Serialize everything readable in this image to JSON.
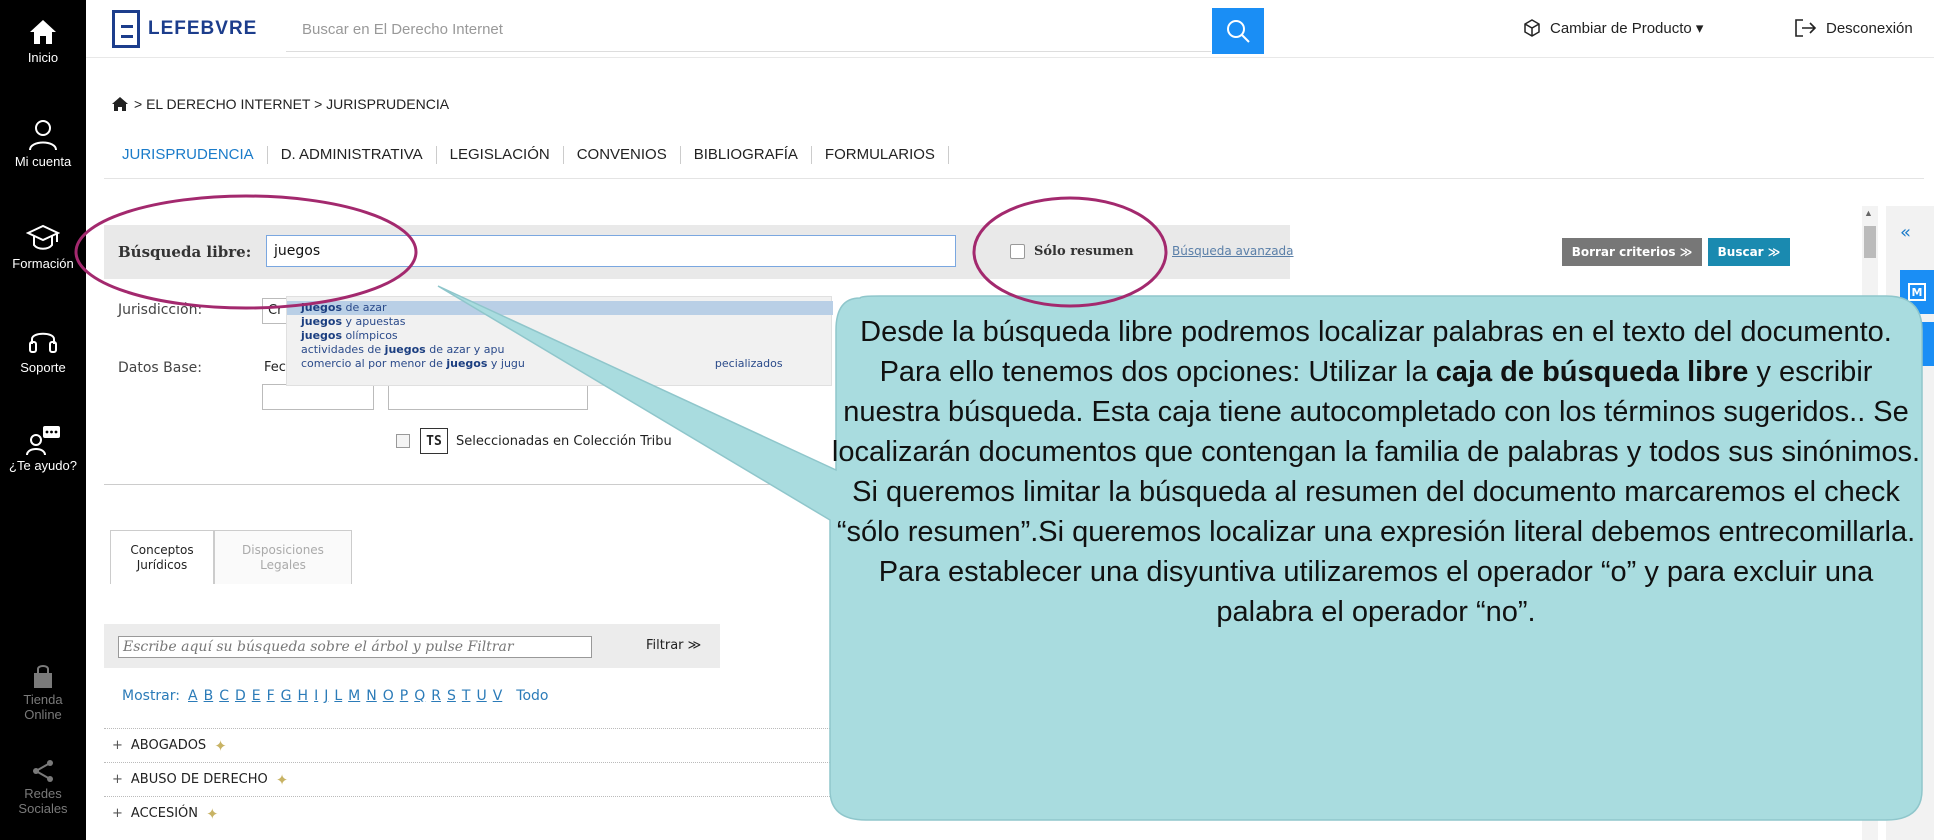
{
  "left_nav": [
    {
      "label": "Inicio",
      "icon": "home-icon"
    },
    {
      "label": "Mi cuenta",
      "icon": "user-icon"
    },
    {
      "label": "Formación",
      "icon": "graduation-cap-icon"
    },
    {
      "label": "Soporte",
      "icon": "headset-icon"
    },
    {
      "label": "¿Te ayudo?",
      "icon": "chat-user-icon"
    },
    {
      "label": "Tienda Online",
      "icon": "shopping-bag-icon"
    },
    {
      "label": "Redes Sociales",
      "icon": "share-icon"
    }
  ],
  "topbar": {
    "logo_text": "LEFEBVRE",
    "search_placeholder": "Buscar en El Derecho Internet",
    "change_product": "Cambiar de Producto ▾",
    "logout": "Desconexión"
  },
  "breadcrumb": "> EL DERECHO INTERNET > JURISPRUDENCIA",
  "tabs": [
    "JURISPRUDENCIA",
    "D. ADMINISTRATIVA",
    "LEGISLACIÓN",
    "CONVENIOS",
    "BIBLIOGRAFÍA",
    "FORMULARIOS"
  ],
  "search": {
    "label": "Búsqueda libre:",
    "value": "juegos",
    "only_summary": "Sólo resumen",
    "advanced_link": "Búsqueda avanzada",
    "clear_button": "Borrar criterios ≫",
    "search_button": "Buscar ≫"
  },
  "autocomplete": [
    {
      "bold": "juegos",
      "rest": " de azar",
      "selected": true
    },
    {
      "bold": "juegos",
      "rest": " y apuestas",
      "selected": false
    },
    {
      "bold": "juegos",
      "rest": " olímpicos",
      "selected": false
    },
    {
      "pre": "actividades de ",
      "bold": "juegos",
      "rest": " de azar y apu",
      "selected": false
    },
    {
      "pre": "comercio al por menor de ",
      "bold": "juegos",
      "rest": " y jugu",
      "tail": "pecializados",
      "selected": false
    }
  ],
  "form": {
    "jurisdiccion_label": "Jurisdicción:",
    "jurisdiccion_value": "Cr",
    "datos_base_label": "Datos Base:",
    "fecha_label": "Fec",
    "ts_badge": "TS",
    "ts_label": "Seleccionadas en Colección Tribu"
  },
  "concept_tabs": [
    "Conceptos\nJurídicos",
    "Disposiciones\nLegales"
  ],
  "filter": {
    "placeholder": "Escribe aquí su búsqueda sobre el árbol y pulse Filtrar",
    "button": "Filtrar ≫"
  },
  "mostrar": {
    "label": "Mostrar:",
    "letters": [
      "A",
      "B",
      "C",
      "D",
      "E",
      "F",
      "G",
      "H",
      "I",
      "J",
      "L",
      "M",
      "N",
      "O",
      "P",
      "Q",
      "R",
      "S",
      "T",
      "U",
      "V"
    ],
    "all": "Todo"
  },
  "tree_items": [
    "ABOGADOS",
    "ABUSO DE DERECHO",
    "ACCESIÓN"
  ],
  "right_rail": {
    "collapse": "«",
    "m_label": "M"
  },
  "callout": {
    "part1": "Desde la búsqueda libre podremos localizar palabras en el texto del documento. Para ello tenemos dos opciones: Utilizar la ",
    "bold": "caja de búsqueda libre",
    "part2": " y escribir nuestra búsqueda. Esta caja tiene autocompletado con los términos sugeridos.. Se localizarán documentos que contengan la familia de palabras y todos sus sinónimos. Si queremos limitar la búsqueda al resumen del documento marcaremos el check “sólo resumen”.Si queremos localizar una expresión literal debemos entrecomillarla. Para establecer una disyuntiva utilizaremos el operador “o” y para excluir una palabra el operador “no”."
  },
  "colors": {
    "accent": "#1a8ef5",
    "brand": "#1c3d8c",
    "callout_fill": "#a9dcdf",
    "highlight": "#a3296e"
  }
}
